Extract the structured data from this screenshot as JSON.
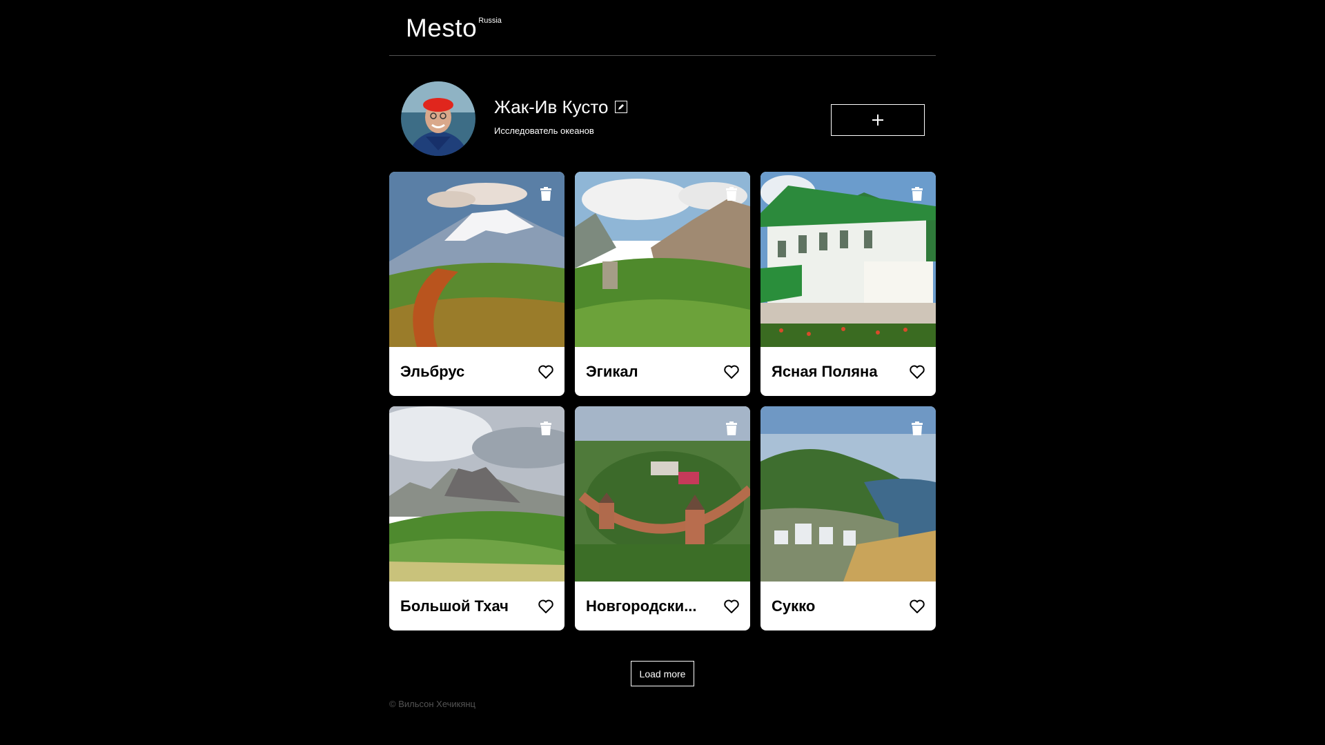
{
  "header": {
    "logo": "Mesto",
    "logo_sup": "Russia"
  },
  "profile": {
    "name": "Жак-Ив Кусто",
    "about": "Исследователь океанов",
    "add_label": "+"
  },
  "cards": [
    {
      "title": "Эльбрус"
    },
    {
      "title": "Эгикал"
    },
    {
      "title": "Ясная Поляна"
    },
    {
      "title": "Большой Тхач"
    },
    {
      "title": "Новгородски..."
    },
    {
      "title": "Сукко"
    }
  ],
  "load_more": "Load more",
  "footer": "© Вильсон Хечикянц",
  "icons": {
    "edit": "pencil-icon",
    "add": "plus-icon",
    "delete": "trash-icon",
    "like": "heart-icon"
  }
}
